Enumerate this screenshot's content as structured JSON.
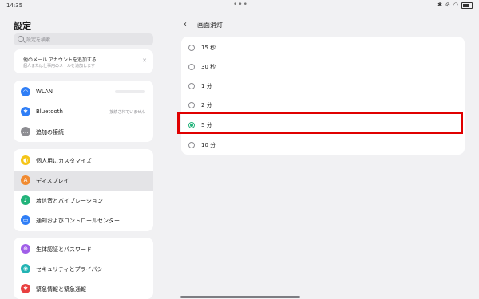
{
  "status_bar": {
    "time": "14:35",
    "dots": "•••",
    "icons": [
      "bluetooth-icon",
      "mute-icon",
      "wifi-icon",
      "battery-icon"
    ]
  },
  "left": {
    "title": "設定",
    "search_placeholder": "設定を検索",
    "account_card": {
      "title": "他のメール アカウントを追加する",
      "subtitle": "個人または仕事用のメールを追加します"
    },
    "groups": [
      [
        {
          "icon": "wifi-icon",
          "label": "WLAN",
          "color": "#2f7ef6",
          "status": ""
        },
        {
          "icon": "bluetooth-icon",
          "label": "Bluetooth",
          "color": "#2f7ef6",
          "status": "接続されていません"
        },
        {
          "icon": "more-icon",
          "label": "追加の接続",
          "color": "#8d8d92",
          "status": ""
        }
      ],
      [
        {
          "icon": "palette-icon",
          "label": "個人用にカスタマイズ",
          "color": "#f5c518"
        },
        {
          "icon": "display-icon",
          "label": "ディスプレイ",
          "color": "#f08a30",
          "selected": true
        },
        {
          "icon": "sound-icon",
          "label": "着信音とバイブレーション",
          "color": "#22b37a"
        },
        {
          "icon": "notification-icon",
          "label": "通知およびコントロールセンター",
          "color": "#2f7ef6"
        }
      ],
      [
        {
          "icon": "biometric-icon",
          "label": "生体認証とパスワード",
          "color": "#a05ee8"
        },
        {
          "icon": "security-icon",
          "label": "セキュリティとプライバシー",
          "color": "#22b3b3"
        },
        {
          "icon": "emergency-icon",
          "label": "緊急情報と緊急通報",
          "color": "#e84040"
        }
      ]
    ]
  },
  "right": {
    "title": "画面消灯",
    "options": [
      {
        "label": "15 秒",
        "checked": false
      },
      {
        "label": "30 秒",
        "checked": false
      },
      {
        "label": "1 分",
        "checked": false
      },
      {
        "label": "2 分",
        "checked": false
      },
      {
        "label": "5 分",
        "checked": true
      },
      {
        "label": "10 分",
        "checked": false
      }
    ],
    "highlight_color": "#e00000",
    "accent_color": "#22b37a"
  }
}
